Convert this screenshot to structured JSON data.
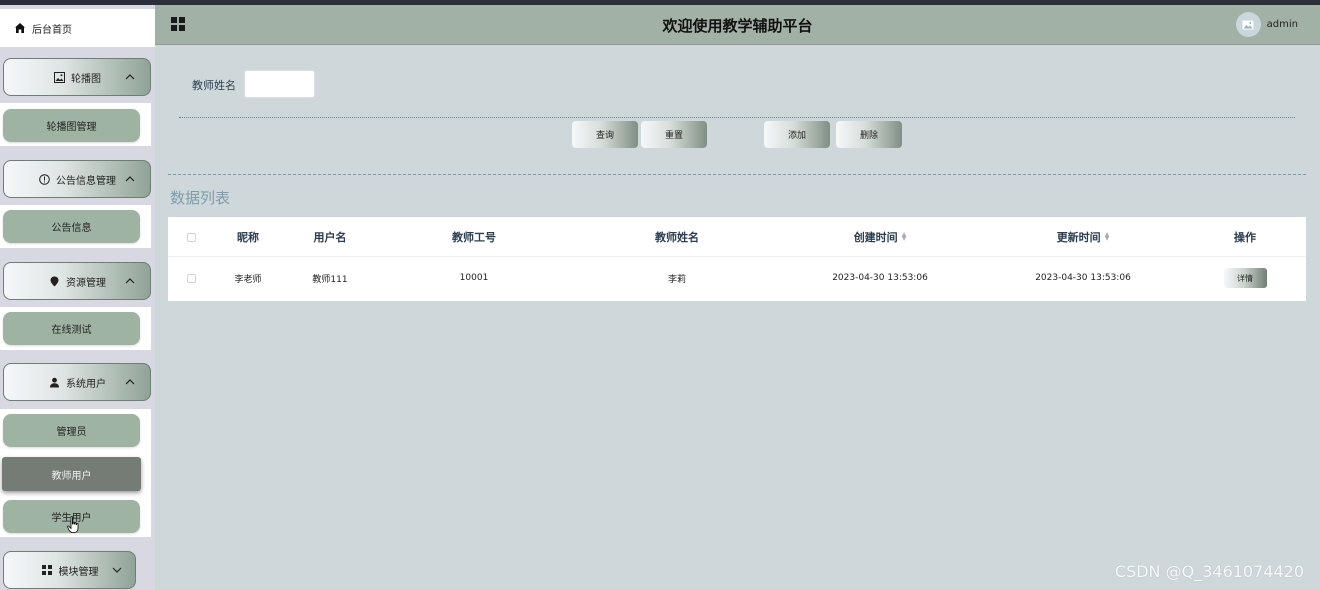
{
  "header": {
    "title": "欢迎使用教学辅助平台",
    "username": "admin"
  },
  "sidebar": {
    "home": "后台首页",
    "groups": [
      {
        "label": "轮播图",
        "icon": "image-icon",
        "chevron": "up",
        "items": [
          "轮播图管理"
        ]
      },
      {
        "label": "公告信息管理",
        "icon": "info-icon",
        "chevron": "up",
        "items": [
          "公告信息"
        ]
      },
      {
        "label": "资源管理",
        "icon": "location-icon",
        "chevron": "up",
        "items": [
          "在线测试"
        ]
      },
      {
        "label": "系统用户",
        "icon": "user-icon",
        "chevron": "up",
        "items": [
          "管理员",
          "教师用户",
          "学生用户"
        ]
      },
      {
        "label": "模块管理",
        "icon": "grid-icon",
        "chevron": "down",
        "items": []
      }
    ],
    "active_item": "教师用户"
  },
  "search": {
    "label": "教师姓名",
    "value": ""
  },
  "buttons": {
    "query": "查询",
    "reset": "重置",
    "add": "添加",
    "delete": "删除"
  },
  "section_title": "数据列表",
  "table": {
    "columns": [
      "昵称",
      "用户名",
      "教师工号",
      "教师姓名",
      "创建时间",
      "更新时间",
      "操作"
    ],
    "rows": [
      {
        "nickname": "李老师",
        "username": "教师111",
        "teacher_no": "10001",
        "teacher_name": "李莉",
        "created": "2023-04-30 13:53:06",
        "updated": "2023-04-30 13:53:06",
        "action": "详情"
      }
    ]
  },
  "watermark": "CSDN @Q_3461074420"
}
